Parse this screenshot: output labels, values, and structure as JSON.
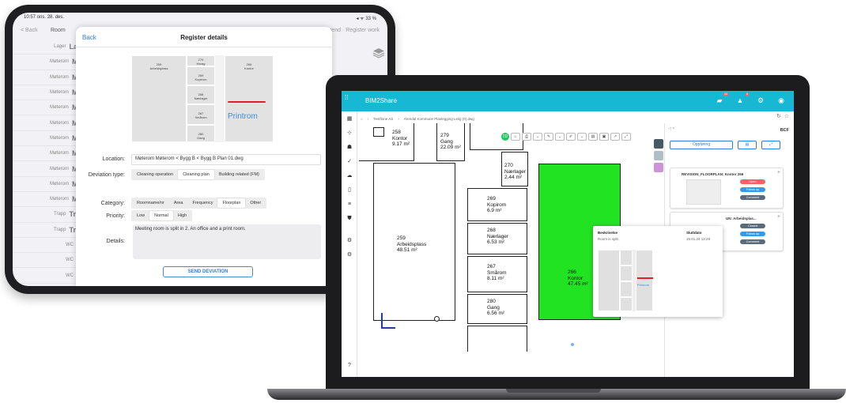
{
  "tablet": {
    "status_time": "10:57  ons. 28. des.",
    "status_right": "◂ ᯤ 33 %",
    "nav_back": "< Back",
    "nav_room": "Room",
    "nav_right": "Legend · Register work",
    "list": [
      {
        "a": "Lager",
        "b": "Lager"
      },
      {
        "a": "Møterom",
        "b": "Møte"
      },
      {
        "a": "Møterom",
        "b": "Møte"
      },
      {
        "a": "Møterom",
        "b": "Møte"
      },
      {
        "a": "Møterom",
        "b": "Møte"
      },
      {
        "a": "Møterom",
        "b": "Møte"
      },
      {
        "a": "Møterom",
        "b": "Møte"
      },
      {
        "a": "Møterom",
        "b": "Møte"
      },
      {
        "a": "Møterom",
        "b": "Møte"
      },
      {
        "a": "Møterom",
        "b": "Møte"
      },
      {
        "a": "Møterom",
        "b": "Møte"
      },
      {
        "a": "Trapp",
        "b": "Trapp"
      },
      {
        "a": "Trapp",
        "b": "Trapp"
      },
      {
        "a": "WC",
        "b": "WC"
      },
      {
        "a": "WC",
        "b": "WC"
      },
      {
        "a": "WC",
        "b": "WC"
      },
      {
        "a": "WC",
        "b": "WC"
      }
    ],
    "modal": {
      "back": "Back",
      "title": "Register details",
      "plan": {
        "r259": "259\nArbeidsplass",
        "r270": "270\nHarag\nrkr",
        "r269": "269\nKopirom",
        "r268": "268\nNærlager",
        "r267": "267\nSmårom",
        "r280": "280\nGang",
        "r266": "266\nKontor",
        "printrom": "Printrom"
      },
      "location_label": "Location:",
      "location_value": "Møterom Møterom < Bygg B < Bygg B Plan 01.dwg",
      "deviation_label": "Deviation type:",
      "deviation_options": [
        "Cleaning operation",
        "Cleaning plan",
        "Building related (FM)"
      ],
      "category_label": "Category:",
      "category_options": [
        "Roomname/nr",
        "Area",
        "Frequency",
        "Floorplan",
        "Other"
      ],
      "priority_label": "Priority:",
      "priority_options": [
        "Low",
        "Normal",
        "High"
      ],
      "details_label": "Details:",
      "details_value": "Meeting room is split in 2. An office and a print room.",
      "send_label": "SEND DEVIATION"
    }
  },
  "laptop": {
    "brand": "BIM2Share",
    "badges": [
      "24",
      "6"
    ],
    "breadcrumb": [
      "Testflone AS",
      "Arendal Kommune Planlegging Leilg (0).dwg"
    ],
    "rooms": {
      "r258": [
        "258",
        "Kontor",
        "9.17 m²"
      ],
      "r279": [
        "279",
        "Gang",
        "22.09 m²"
      ],
      "r270": [
        "270",
        "Nærlager",
        "2.44 m²"
      ],
      "r269": [
        "269",
        "Kopirom",
        "6.9 m²"
      ],
      "r268": [
        "268",
        "Nærlager",
        "6.53 m²"
      ],
      "r267": [
        "267",
        "Smårom",
        "8.11 m²"
      ],
      "r280": [
        "280",
        "Gang",
        "6.56 m²"
      ],
      "r259": [
        "259",
        "Arbeidsplass",
        "48.51 m²"
      ],
      "r266": [
        "266",
        "Kontor",
        "47.45 m²"
      ]
    },
    "panel": {
      "bcf": "BCF",
      "btn_filter": "Oppføring",
      "card1_title": "REVISION_FLOORPLAN: Kontor 266",
      "card2_title": "UN: Arbeidsplas...",
      "pills1": [
        "Open",
        "Follow up",
        "Comment"
      ],
      "pills2": [
        "Closed",
        "Follow up",
        "Comment"
      ]
    },
    "popup": {
      "label_desc": "Beskrivelse",
      "desc": "Room is split.",
      "label_date": "Sluttdato",
      "date": "15.01.24 12:29",
      "printrom": "Printrom"
    },
    "colors": {
      "topbar": "#16b8d4",
      "highlight": "#22e322",
      "open": "#ff5d6a",
      "followup": "#2d9cf2",
      "comment": "#5a6b7c",
      "closed": "#5a6b7c"
    }
  }
}
